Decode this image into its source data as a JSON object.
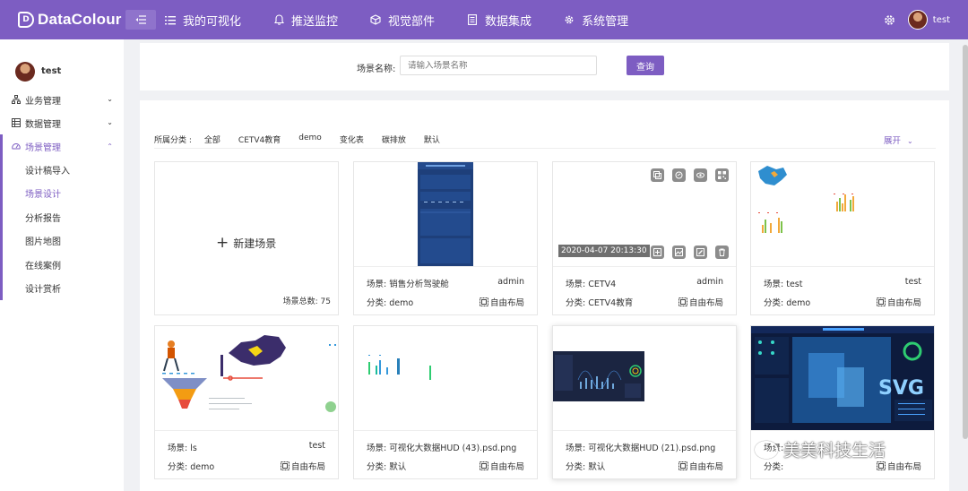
{
  "header": {
    "logo": "DataColour",
    "nav": [
      {
        "label": "我的可视化",
        "icon": "list-icon"
      },
      {
        "label": "推送监控",
        "icon": "bell-icon"
      },
      {
        "label": "视觉部件",
        "icon": "cube-icon"
      },
      {
        "label": "数据集成",
        "icon": "document-icon"
      },
      {
        "label": "系统管理",
        "icon": "gear-icon"
      }
    ],
    "username": "test"
  },
  "sidebar": {
    "username": "test",
    "groups": [
      {
        "label": "业务管理",
        "icon": "sitemap-icon"
      },
      {
        "label": "数据管理",
        "icon": "table-icon"
      },
      {
        "label": "场景管理",
        "icon": "dashboard-icon"
      }
    ],
    "sub_items": [
      "设计稿导入",
      "场景设计",
      "分析报告",
      "图片地图",
      "在线案例",
      "设计赏析"
    ]
  },
  "search": {
    "label": "场景名称:",
    "placeholder": "请输入场景名称",
    "button": "查询"
  },
  "filters": {
    "title": "所属分类 :",
    "options": [
      "全部",
      "CETV4教育",
      "demo",
      "变化表",
      "碳排放",
      "默认"
    ],
    "expand": "展开"
  },
  "new_card": {
    "label": "新建场景",
    "total": "场景总数: 75"
  },
  "cards": [
    {
      "name": "场景: 销售分析驾驶舱",
      "owner": "admin",
      "category": "分类: demo",
      "layout": "自由布局"
    },
    {
      "name": "场景: CETV4",
      "owner": "admin",
      "category": "分类: CETV4教育",
      "layout": "自由布局",
      "date": "2020-04-07 20:13:30"
    },
    {
      "name": "场景: test",
      "owner": "test",
      "category": "分类: demo",
      "layout": "自由布局"
    },
    {
      "name": "场景: ls",
      "owner": "test",
      "category": "分类: demo",
      "layout": "自由布局"
    },
    {
      "name": "场景: 可视化大数据HUD (43).psd.png",
      "owner": "",
      "category": "分类: 默认",
      "layout": "自由布局"
    },
    {
      "name": "场景: 可视化大数据HUD (21).psd.png",
      "owner": "",
      "category": "分类: 默认",
      "layout": "自由布局"
    },
    {
      "name": "场景: ",
      "owner": "",
      "category": "分类: ",
      "layout": "自由布局"
    }
  ],
  "watermark": "美美科技生活",
  "colors": {
    "brand": "#7d5dc2"
  }
}
